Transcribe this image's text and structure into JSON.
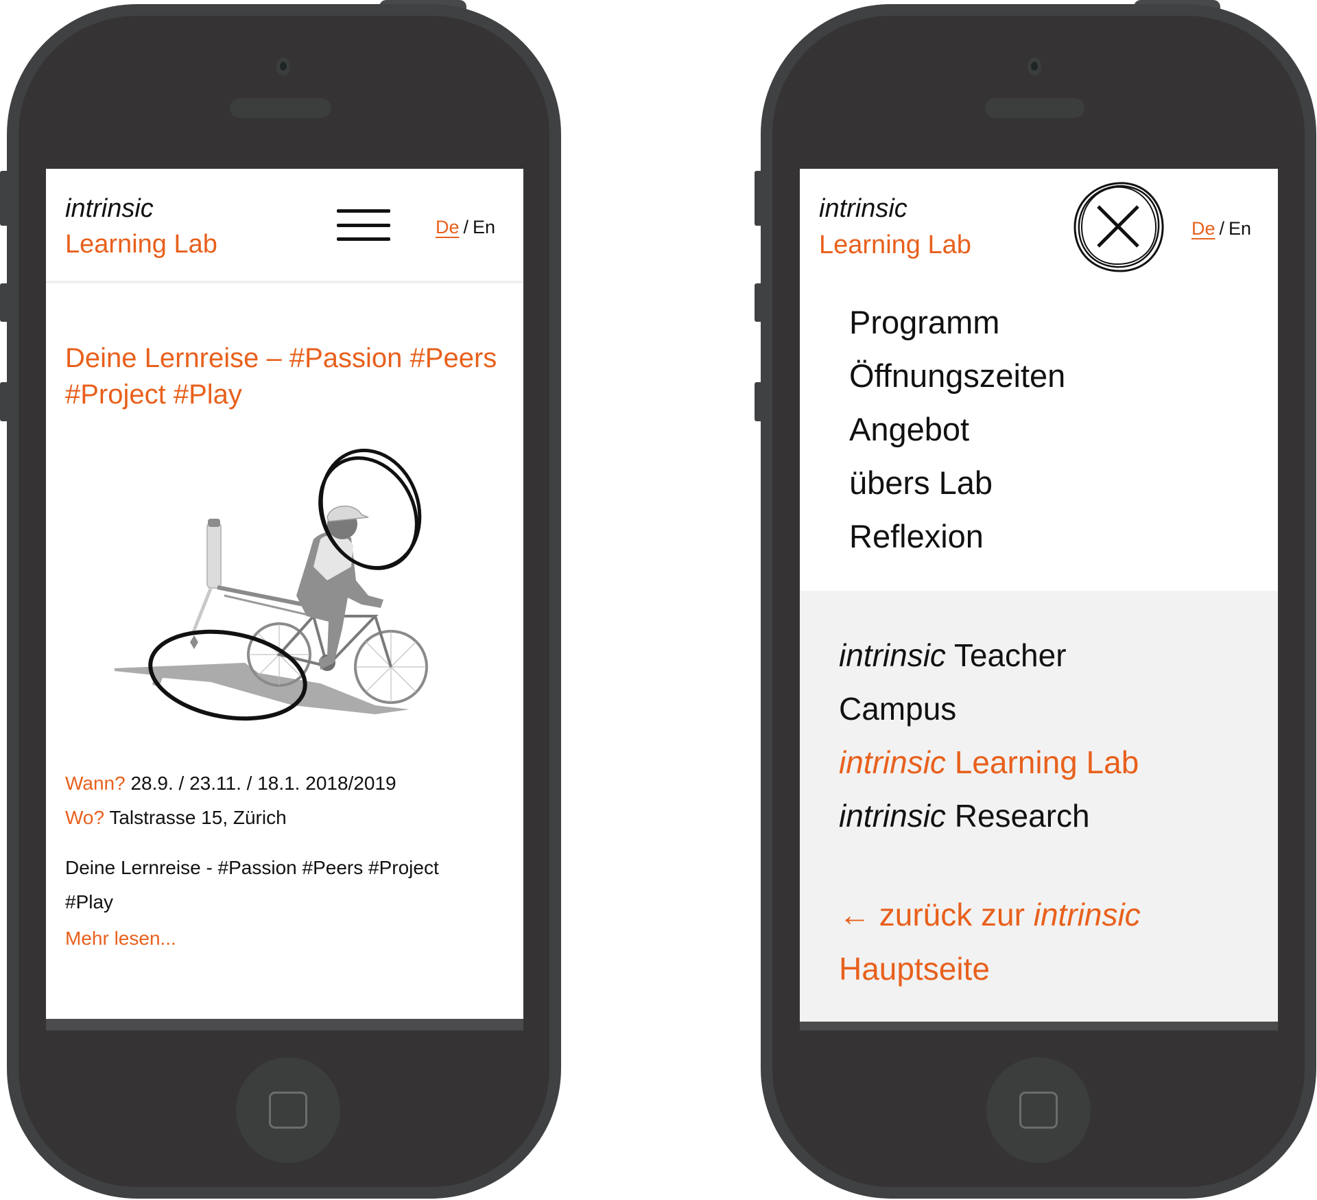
{
  "brand": {
    "logo_line1": "intrinsic",
    "logo_line2": "Learning Lab",
    "accent_color": "#e8601c",
    "text_color": "#111111"
  },
  "language_switch": {
    "de": "De",
    "separator": "/",
    "en": "En",
    "active": "De"
  },
  "left_phone": {
    "menu_icon": "hamburger-menu-icon",
    "hero_title": "Deine Lernreise – #Passion #Peers #Project #Play",
    "image_alt": "Person auf einem Fahrrad mit Rakete, eingekreist",
    "when_label": "Wann?",
    "when_value": "28.9. / 23.11. / 18.1. 2018/2019",
    "where_label": "Wo?",
    "where_value": "Talstrasse 15, Zürich",
    "excerpt": "Deine Lernreise - #Passion #Peers #Project #Play",
    "read_more": "Mehr lesen..."
  },
  "right_phone": {
    "close_icon": "close-icon",
    "nav_items": [
      {
        "label": "Programm"
      },
      {
        "label": "Öffnungszeiten"
      },
      {
        "label": "Angebot"
      },
      {
        "label": "übers Lab"
      },
      {
        "label": "Reflexion"
      }
    ],
    "sites": [
      {
        "prefix": "intrinsic",
        "label": "Teacher",
        "active": false
      },
      {
        "prefix": "",
        "label": "Campus",
        "active": false
      },
      {
        "prefix": "intrinsic",
        "label": "Learning Lab",
        "active": true
      },
      {
        "prefix": "intrinsic",
        "label": "Research",
        "active": false
      }
    ],
    "back_arrow": "←",
    "back_text": "zurück zur",
    "back_italic": "intrinsic",
    "back_text2": "Hauptseite"
  }
}
